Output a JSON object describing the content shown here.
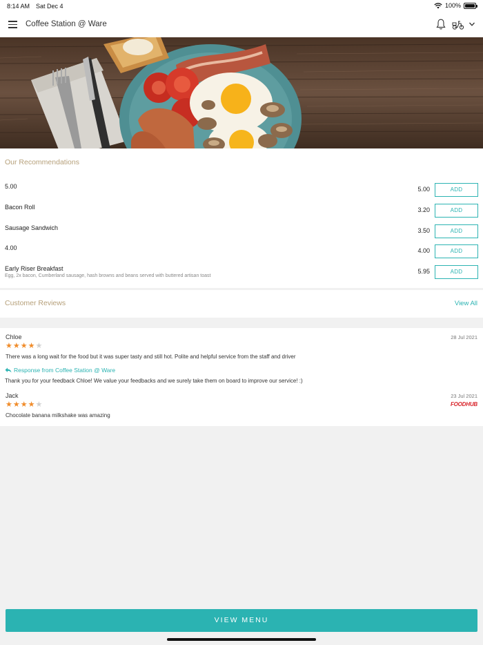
{
  "status_bar": {
    "time": "8:14 AM",
    "date": "Sat Dec 4",
    "battery": "100%"
  },
  "header": {
    "title": "Coffee Station @ Ware"
  },
  "recommendations": {
    "title": "Our Recommendations",
    "add_label": "ADD",
    "items": [
      {
        "name": "5.00",
        "price": "5.00",
        "description": ""
      },
      {
        "name": "Bacon Roll",
        "price": "3.20",
        "description": ""
      },
      {
        "name": "Sausage Sandwich",
        "price": "3.50",
        "description": ""
      },
      {
        "name": "4.00",
        "price": "4.00",
        "description": ""
      },
      {
        "name": "Early Riser Breakfast",
        "price": "5.95",
        "description": "Egg, 2x bacon, Cumberland sausage, hash browns and beans served with buttered artisan toast"
      }
    ]
  },
  "reviews": {
    "title": "Customer Reviews",
    "view_all": "View All",
    "items": [
      {
        "name": "Chloe",
        "date": "28 Jul 2021",
        "rating": 4,
        "text": "There was a long wait for the food but it was super tasty and still hot. Polite and helpful service from the staff and driver",
        "response_heading": "Response from Coffee Station @ Ware",
        "response_text": "Thank you for your feedback Chloe! We value your feedbacks and we surely take them on board to improve our service! :)"
      },
      {
        "name": "Jack",
        "date": "23 Jul 2021",
        "rating": 4,
        "text": "Chocolate banana milkshake was amazing",
        "source": "FOODHUB"
      }
    ]
  },
  "footer": {
    "view_menu": "VIEW MENU"
  },
  "colors": {
    "accent": "#2bb3b2",
    "section_title": "#b6a07a",
    "star": "#f08c2a",
    "foodhub": "#d8232a"
  }
}
